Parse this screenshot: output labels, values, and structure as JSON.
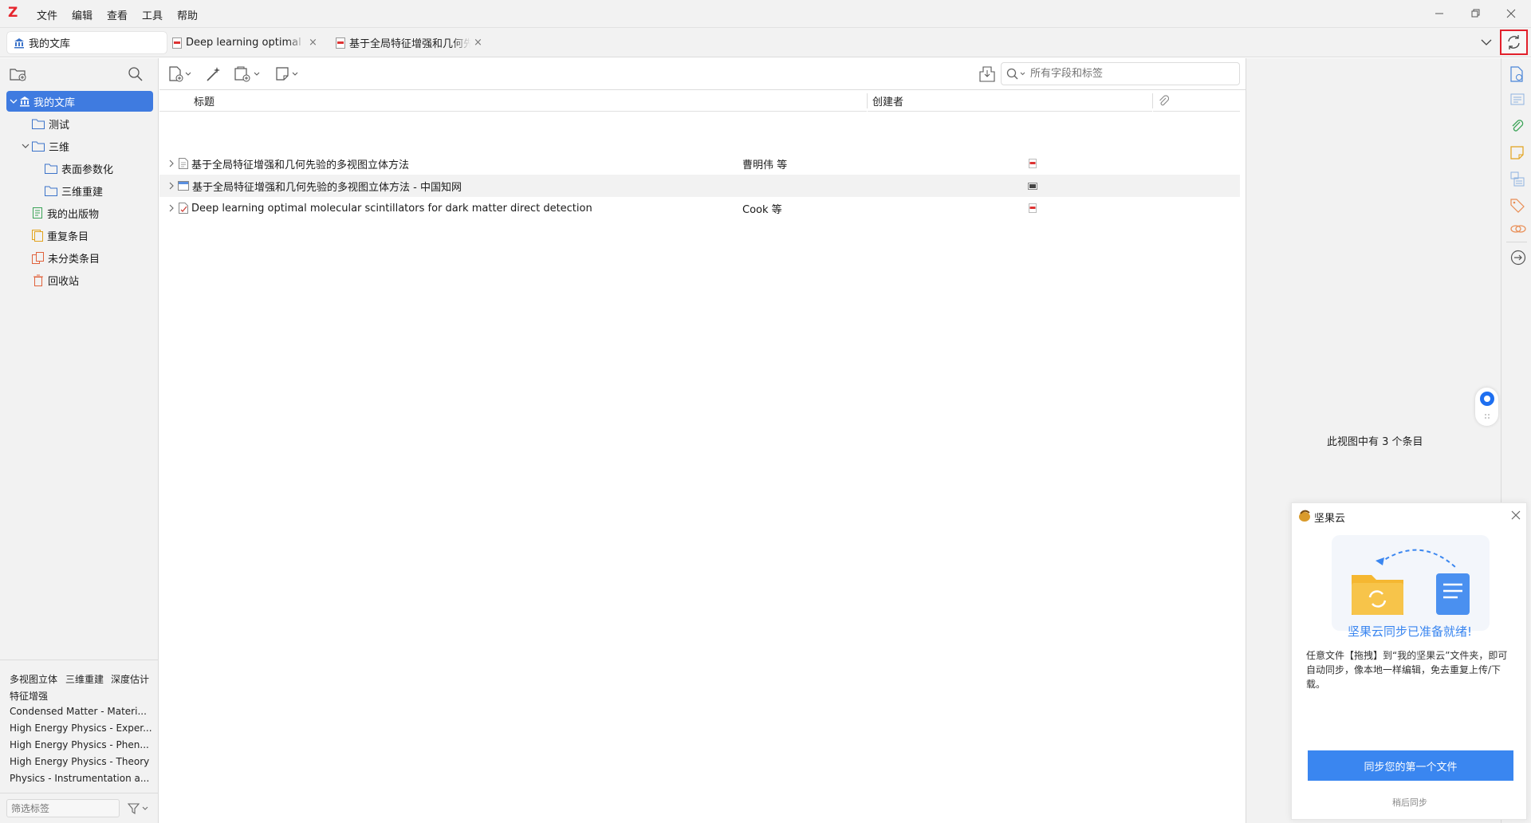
{
  "app": {
    "logo": "Z"
  },
  "menu": [
    "文件",
    "编辑",
    "查看",
    "工具",
    "帮助"
  ],
  "tabs": [
    {
      "label": "我的文库",
      "icon": "library-icon"
    },
    {
      "label": "Deep learning optimal m",
      "icon": "pdf-icon"
    },
    {
      "label": "基于全局特征增强和几何先验",
      "icon": "pdf-icon"
    }
  ],
  "collections": [
    {
      "label": "我的文库",
      "icon": "library-icon",
      "level": 0,
      "expanded": true,
      "selected": true
    },
    {
      "label": "测试",
      "icon": "folder-icon",
      "level": 1
    },
    {
      "label": "三维",
      "icon": "folder-icon",
      "level": 1,
      "expanded": true
    },
    {
      "label": "表面参数化",
      "icon": "folder-icon",
      "level": 2
    },
    {
      "label": "三维重建",
      "icon": "folder-icon",
      "level": 2
    },
    {
      "label": "我的出版物",
      "icon": "publications-icon",
      "level": 1
    },
    {
      "label": "重复条目",
      "icon": "duplicate-icon",
      "level": 1
    },
    {
      "label": "未分类条目",
      "icon": "unfiled-icon",
      "level": 1
    },
    {
      "label": "回收站",
      "icon": "trash-icon",
      "level": 1
    }
  ],
  "tags": {
    "row1": [
      "多视图立体",
      "三维重建",
      "深度估计"
    ],
    "row2": [
      "特征增强"
    ],
    "list": [
      "Condensed Matter - Materi...",
      "High Energy Physics - Exper...",
      "High Energy Physics - Phen...",
      "High Energy Physics - Theory",
      "Physics - Instrumentation a..."
    ],
    "filter_placeholder": "筛选标签"
  },
  "search": {
    "placeholder": "所有字段和标签"
  },
  "columns": {
    "title": "标题",
    "creator": "创建者"
  },
  "items": [
    {
      "title": "基于全局特征增强和几何先验的多视图立体方法",
      "creator": "曹明伟 等",
      "type_icon": "document-icon",
      "attachment_icon": "pdf-attachment-icon"
    },
    {
      "title": "基于全局特征增强和几何先验的多视图立体方法 - 中国知网",
      "creator": "",
      "type_icon": "webpage-icon",
      "attachment_icon": "snapshot-attachment-icon"
    },
    {
      "title": "Deep learning optimal molecular scintillators for dark matter direct detection",
      "creator": "Cook 等",
      "type_icon": "preprint-icon",
      "attachment_icon": "pdf-attachment-icon"
    }
  ],
  "item_pane": {
    "count_message": "此视图中有 3 个条目"
  },
  "popup": {
    "brand": "坚果云",
    "headline": "坚果云同步已准备就绪!",
    "body": "任意文件【拖拽】到“我的坚果云”文件夹，即可自动同步，像本地一样编辑，免去重复上传/下载。",
    "primary_button": "同步您的第一个文件",
    "secondary_link": "稍后同步"
  },
  "colors": {
    "accent": "#3f7be0",
    "highlight_red": "#e2202b",
    "popup_blue": "#3a86f0"
  }
}
